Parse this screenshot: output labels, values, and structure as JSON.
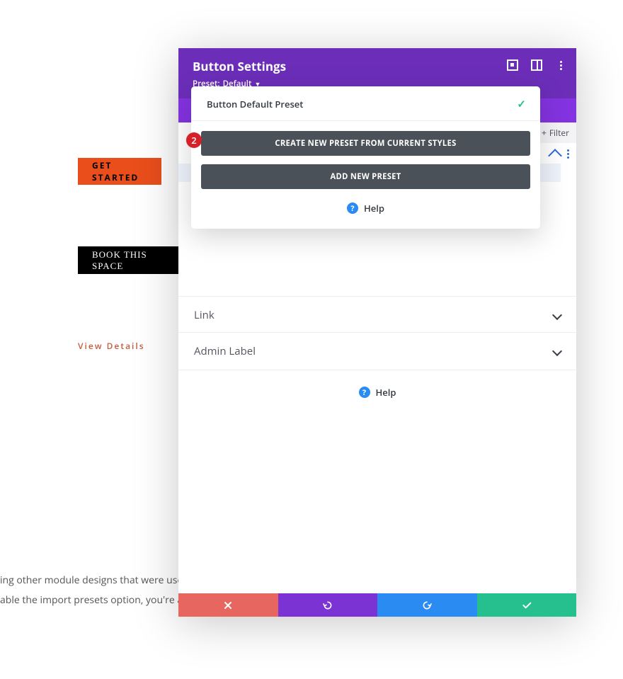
{
  "bg": {
    "get_started": "GET STARTED",
    "book_space": "BOOK THIS SPACE",
    "view_details": "View Details",
    "para_line1": "ing other module designs that were use",
    "para_line2": "able the import presets option, you're a"
  },
  "panel": {
    "title": "Button Settings",
    "preset_prefix": "Preset:",
    "preset_name": "Default",
    "icons": {
      "scope": "scope-icon",
      "split": "responsive-split-icon",
      "menu": "menu-dots-icon"
    }
  },
  "filter": {
    "label": "Filter"
  },
  "accordion": {
    "link": "Link",
    "admin_label": "Admin Label"
  },
  "help_label": "Help",
  "dropdown": {
    "active_preset": "Button Default Preset",
    "btn_create": "CREATE NEW PRESET FROM CURRENT STYLES",
    "btn_add": "ADD NEW PRESET"
  },
  "badge": {
    "step": "2"
  },
  "actions": {
    "cancel": "cancel",
    "undo": "undo",
    "redo": "redo",
    "save": "save"
  }
}
